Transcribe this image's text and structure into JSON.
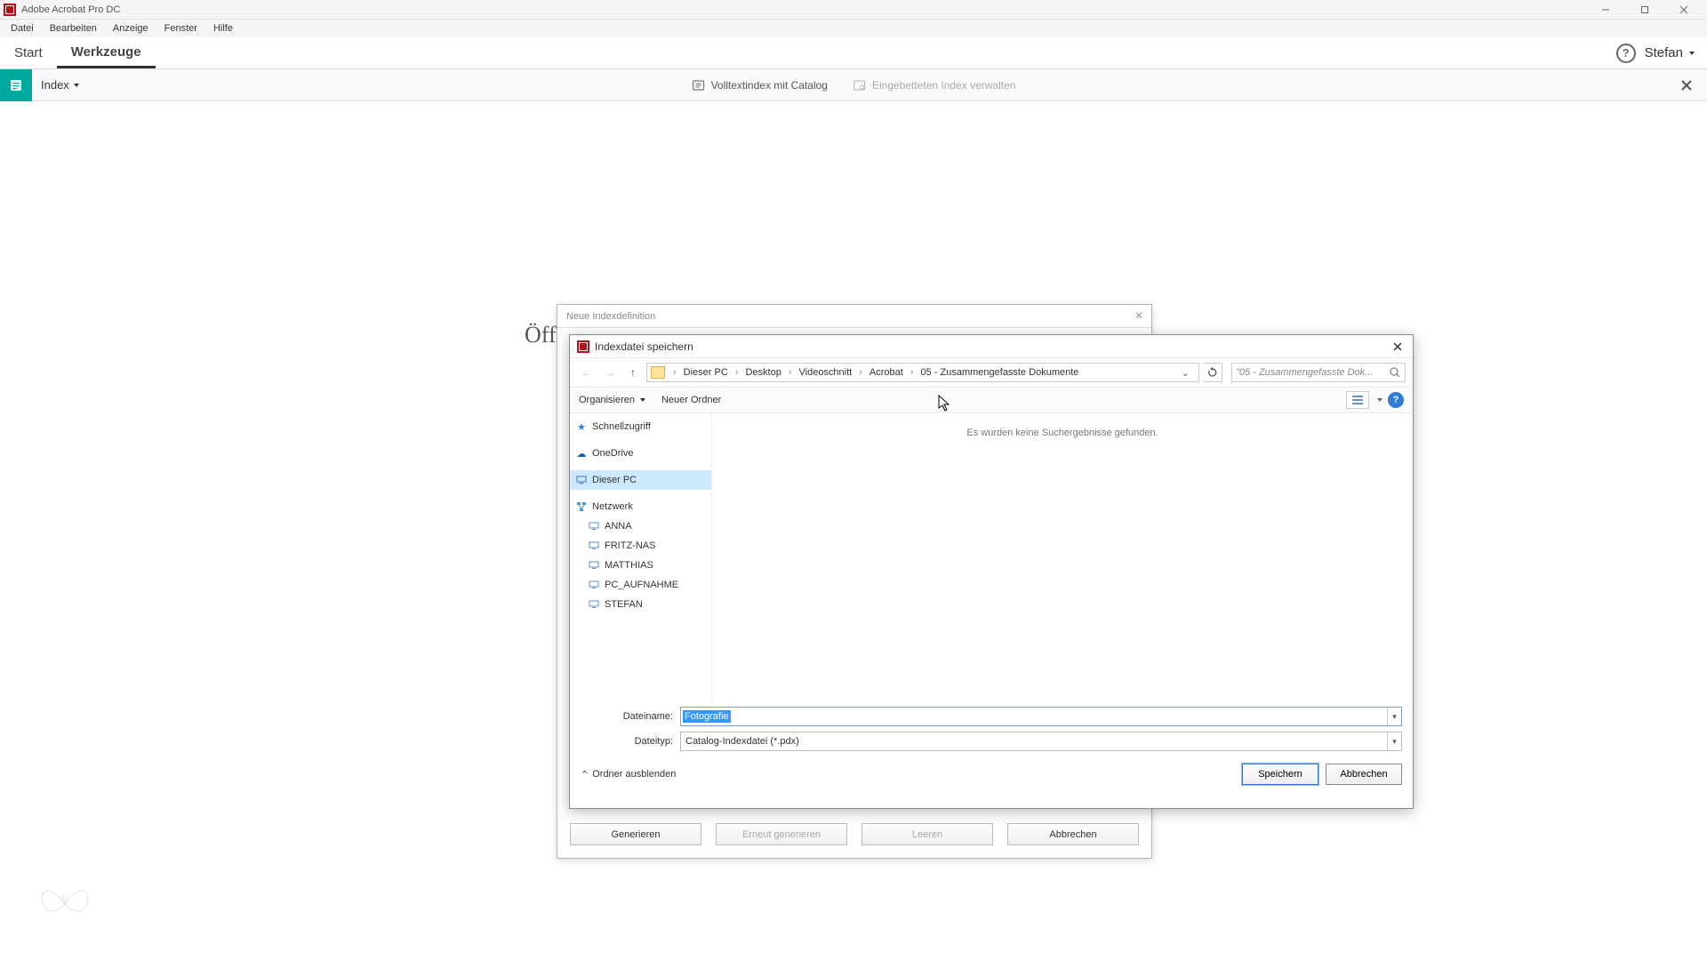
{
  "app": {
    "title": "Adobe Acrobat Pro DC"
  },
  "menubar": {
    "items": [
      "Datei",
      "Bearbeiten",
      "Anzeige",
      "Fenster",
      "Hilfe"
    ]
  },
  "topnav": {
    "start": "Start",
    "tools": "Werkzeuge",
    "user": "Stefan"
  },
  "toolstrip": {
    "index_label": "Index",
    "tool1": "Volltextindex mit Catalog",
    "tool2": "Eingebetteten Index verwalten"
  },
  "main": {
    "partial_text": "Öff"
  },
  "bg_dialog": {
    "title": "Neue Indexdefinition",
    "btn_generate": "Generieren",
    "btn_regenerate": "Erneut generieren",
    "btn_clear": "Leeren",
    "btn_cancel": "Abbrechen"
  },
  "save_dialog": {
    "title": "Indexdatei speichern",
    "breadcrumbs": [
      "Dieser PC",
      "Desktop",
      "Videoschnitt",
      "Acrobat",
      "05 - Zusammengefasste Dokumente"
    ],
    "search_placeholder": "\"05 - Zusammengefasste Dok...",
    "organize": "Organisieren",
    "new_folder": "Neuer Ordner",
    "tree": {
      "quick_access": "Schnellzugriff",
      "onedrive": "OneDrive",
      "this_pc": "Dieser PC",
      "network": "Netzwerk",
      "computers": [
        "ANNA",
        "FRITZ-NAS",
        "MATTHIAS",
        "PC_AUFNAHME",
        "STEFAN"
      ]
    },
    "empty_msg": "Es wurden keine Suchergebnisse gefunden.",
    "filename_label": "Dateiname:",
    "filename_value": "Fotografie",
    "filetype_label": "Dateityp:",
    "filetype_value": "Catalog-Indexdatei (*.pdx)",
    "hide_folders": "Ordner ausblenden",
    "btn_save": "Speichern",
    "btn_cancel": "Abbrechen"
  }
}
